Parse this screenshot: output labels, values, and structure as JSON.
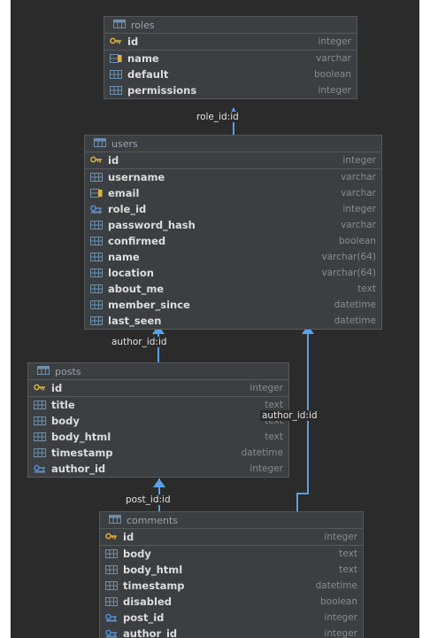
{
  "tables": [
    {
      "name": "roles",
      "columns": [
        {
          "name": "id",
          "type": "integer",
          "icon": "primary-key-icon"
        },
        {
          "name": "name",
          "type": "varchar",
          "icon": "indexed-column-icon"
        },
        {
          "name": "default",
          "type": "boolean",
          "icon": "column-icon"
        },
        {
          "name": "permissions",
          "type": "integer",
          "icon": "column-icon"
        }
      ]
    },
    {
      "name": "users",
      "columns": [
        {
          "name": "id",
          "type": "integer",
          "icon": "primary-key-icon"
        },
        {
          "name": "username",
          "type": "varchar",
          "icon": "column-icon"
        },
        {
          "name": "email",
          "type": "varchar",
          "icon": "indexed-column-icon"
        },
        {
          "name": "role_id",
          "type": "integer",
          "icon": "foreign-key-icon"
        },
        {
          "name": "password_hash",
          "type": "varchar",
          "icon": "column-icon"
        },
        {
          "name": "confirmed",
          "type": "boolean",
          "icon": "column-icon"
        },
        {
          "name": "name",
          "type": "varchar(64)",
          "icon": "column-icon"
        },
        {
          "name": "location",
          "type": "varchar(64)",
          "icon": "column-icon"
        },
        {
          "name": "about_me",
          "type": "text",
          "icon": "column-icon"
        },
        {
          "name": "member_since",
          "type": "datetime",
          "icon": "column-icon"
        },
        {
          "name": "last_seen",
          "type": "datetime",
          "icon": "column-icon"
        }
      ]
    },
    {
      "name": "posts",
      "columns": [
        {
          "name": "id",
          "type": "integer",
          "icon": "primary-key-icon"
        },
        {
          "name": "title",
          "type": "text",
          "icon": "column-icon"
        },
        {
          "name": "body",
          "type": "text",
          "icon": "column-icon"
        },
        {
          "name": "body_html",
          "type": "text",
          "icon": "column-icon"
        },
        {
          "name": "timestamp",
          "type": "datetime",
          "icon": "column-icon"
        },
        {
          "name": "author_id",
          "type": "integer",
          "icon": "foreign-key-icon"
        }
      ]
    },
    {
      "name": "comments",
      "columns": [
        {
          "name": "id",
          "type": "integer",
          "icon": "primary-key-icon"
        },
        {
          "name": "body",
          "type": "text",
          "icon": "column-icon"
        },
        {
          "name": "body_html",
          "type": "text",
          "icon": "column-icon"
        },
        {
          "name": "timestamp",
          "type": "datetime",
          "icon": "column-icon"
        },
        {
          "name": "disabled",
          "type": "boolean",
          "icon": "column-icon"
        },
        {
          "name": "post_id",
          "type": "integer",
          "icon": "foreign-key-icon"
        },
        {
          "name": "author_id",
          "type": "integer",
          "icon": "foreign-key-icon"
        }
      ]
    }
  ],
  "relations": [
    {
      "label": "role_id:id",
      "from": "users",
      "to": "roles"
    },
    {
      "label": "author_id:id",
      "from": "posts",
      "to": "users"
    },
    {
      "label": "author_id:id",
      "from": "comments",
      "to": "users"
    },
    {
      "label": "post_id:id",
      "from": "comments",
      "to": "posts"
    }
  ],
  "colors": {
    "background": "#2b2b2b",
    "table_fill": "#3c3f41",
    "relation_arrow": "#5aa0e6",
    "primary_key": "#e0b040",
    "column_icon": "#6d8fb0"
  }
}
